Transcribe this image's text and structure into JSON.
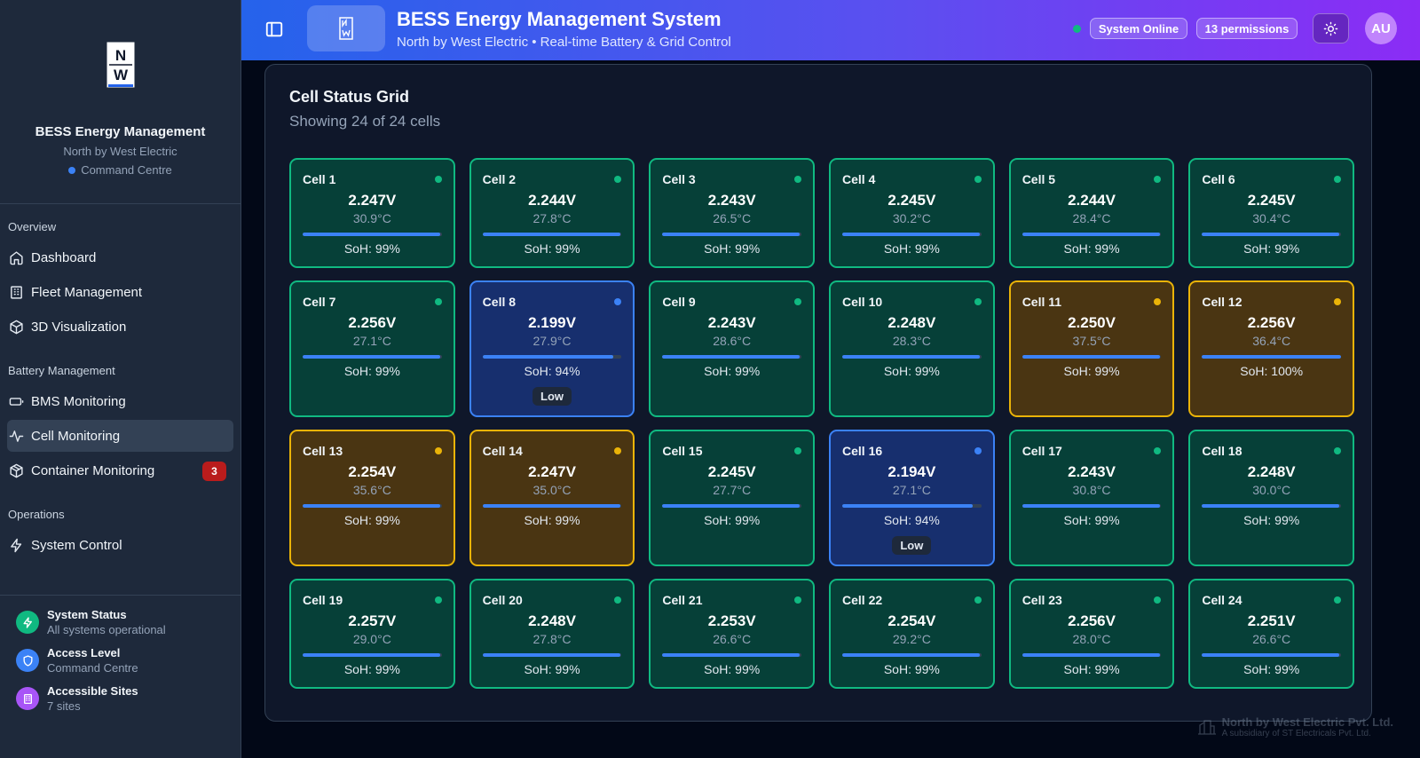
{
  "sidebar": {
    "brand_title": "BESS Energy Management",
    "brand_sub": "North by West Electric",
    "brand_role": "Command Centre",
    "sections": [
      {
        "title": "Overview",
        "items": [
          {
            "label": "Dashboard",
            "icon": "home-icon"
          },
          {
            "label": "Fleet Management",
            "icon": "building-icon"
          },
          {
            "label": "3D Visualization",
            "icon": "cube-icon"
          }
        ]
      },
      {
        "title": "Battery Management",
        "items": [
          {
            "label": "BMS Monitoring",
            "icon": "battery-icon"
          },
          {
            "label": "Cell Monitoring",
            "icon": "activity-icon",
            "active": true
          },
          {
            "label": "Container Monitoring",
            "icon": "package-icon",
            "badge": "3"
          }
        ]
      },
      {
        "title": "Operations",
        "items": [
          {
            "label": "System Control",
            "icon": "zap-icon"
          }
        ]
      }
    ],
    "footer": [
      {
        "title": "System Status",
        "sub": "All systems operational",
        "color": "#10b981",
        "icon": "zap-icon"
      },
      {
        "title": "Access Level",
        "sub": "Command Centre",
        "color": "#3b82f6",
        "icon": "shield-icon"
      },
      {
        "title": "Accessible Sites",
        "sub": "7 sites",
        "color": "#a855f7",
        "icon": "building-icon"
      }
    ]
  },
  "header": {
    "title": "BESS Energy Management System",
    "subtitle": "North by West Electric • Real-time Battery & Grid Control",
    "status_label": "System Online",
    "permissions_label": "13 permissions",
    "avatar_initials": "AU"
  },
  "grid": {
    "title": "Cell Status Grid",
    "subtitle": "Showing 24 of 24 cells",
    "rows": [
      [
        {
          "name": "Cell 1",
          "voltage": "2.247V",
          "temp": "30.9°C",
          "soh": "SoH: 99%",
          "soh_value": 99,
          "status": "normal"
        },
        {
          "name": "Cell 2",
          "voltage": "2.244V",
          "temp": "27.8°C",
          "soh": "SoH: 99%",
          "soh_value": 99,
          "status": "normal"
        },
        {
          "name": "Cell 3",
          "voltage": "2.243V",
          "temp": "26.5°C",
          "soh": "SoH: 99%",
          "soh_value": 99,
          "status": "normal"
        },
        {
          "name": "Cell 4",
          "voltage": "2.245V",
          "temp": "30.2°C",
          "soh": "SoH: 99%",
          "soh_value": 99,
          "status": "normal"
        },
        {
          "name": "Cell 5",
          "voltage": "2.244V",
          "temp": "28.4°C",
          "soh": "SoH: 99%",
          "soh_value": 99,
          "status": "normal"
        },
        {
          "name": "Cell 6",
          "voltage": "2.245V",
          "temp": "30.4°C",
          "soh": "SoH: 99%",
          "soh_value": 99,
          "status": "normal"
        }
      ],
      [
        {
          "name": "Cell 7",
          "voltage": "2.256V",
          "temp": "27.1°C",
          "soh": "SoH: 99%",
          "soh_value": 99,
          "status": "normal"
        },
        {
          "name": "Cell 8",
          "voltage": "2.199V",
          "temp": "27.9°C",
          "soh": "SoH: 94%",
          "soh_value": 94,
          "status": "low",
          "tag": "Low"
        },
        {
          "name": "Cell 9",
          "voltage": "2.243V",
          "temp": "28.6°C",
          "soh": "SoH: 99%",
          "soh_value": 99,
          "status": "normal"
        },
        {
          "name": "Cell 10",
          "voltage": "2.248V",
          "temp": "28.3°C",
          "soh": "SoH: 99%",
          "soh_value": 99,
          "status": "normal"
        },
        {
          "name": "Cell 11",
          "voltage": "2.250V",
          "temp": "37.5°C",
          "soh": "SoH: 99%",
          "soh_value": 99,
          "status": "warn"
        },
        {
          "name": "Cell 12",
          "voltage": "2.256V",
          "temp": "36.4°C",
          "soh": "SoH: 100%",
          "soh_value": 100,
          "status": "warn"
        }
      ],
      [
        {
          "name": "Cell 13",
          "voltage": "2.254V",
          "temp": "35.6°C",
          "soh": "SoH: 99%",
          "soh_value": 99,
          "status": "warn"
        },
        {
          "name": "Cell 14",
          "voltage": "2.247V",
          "temp": "35.0°C",
          "soh": "SoH: 99%",
          "soh_value": 99,
          "status": "warn"
        },
        {
          "name": "Cell 15",
          "voltage": "2.245V",
          "temp": "27.7°C",
          "soh": "SoH: 99%",
          "soh_value": 99,
          "status": "normal"
        },
        {
          "name": "Cell 16",
          "voltage": "2.194V",
          "temp": "27.1°C",
          "soh": "SoH: 94%",
          "soh_value": 94,
          "status": "low",
          "tag": "Low"
        },
        {
          "name": "Cell 17",
          "voltage": "2.243V",
          "temp": "30.8°C",
          "soh": "SoH: 99%",
          "soh_value": 99,
          "status": "normal"
        },
        {
          "name": "Cell 18",
          "voltage": "2.248V",
          "temp": "30.0°C",
          "soh": "SoH: 99%",
          "soh_value": 99,
          "status": "normal"
        }
      ],
      [
        {
          "name": "Cell 19",
          "voltage": "2.257V",
          "temp": "29.0°C",
          "soh": "SoH: 99%",
          "soh_value": 99,
          "status": "normal"
        },
        {
          "name": "Cell 20",
          "voltage": "2.248V",
          "temp": "27.8°C",
          "soh": "SoH: 99%",
          "soh_value": 99,
          "status": "normal"
        },
        {
          "name": "Cell 21",
          "voltage": "2.253V",
          "temp": "26.6°C",
          "soh": "SoH: 99%",
          "soh_value": 99,
          "status": "normal"
        },
        {
          "name": "Cell 22",
          "voltage": "2.254V",
          "temp": "29.2°C",
          "soh": "SoH: 99%",
          "soh_value": 99,
          "status": "normal"
        },
        {
          "name": "Cell 23",
          "voltage": "2.256V",
          "temp": "28.0°C",
          "soh": "SoH: 99%",
          "soh_value": 99,
          "status": "normal"
        },
        {
          "name": "Cell 24",
          "voltage": "2.251V",
          "temp": "26.6°C",
          "soh": "SoH: 99%",
          "soh_value": 99,
          "status": "normal"
        }
      ]
    ]
  },
  "watermark": {
    "line1": "North by West Electric Pvt. Ltd.",
    "line2": "A subsidiary of ST Electricals Pvt. Ltd."
  }
}
